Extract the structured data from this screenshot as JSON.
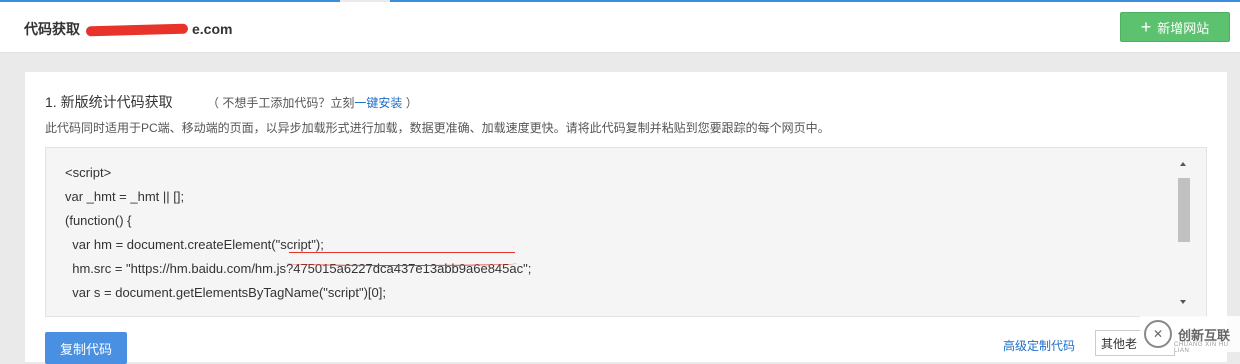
{
  "header": {
    "title": "代码获取",
    "domain_suffix": "e.com",
    "add_site_button": "新增网站",
    "add_site_icon": "plus-icon"
  },
  "section": {
    "title": "1. 新版统计代码获取",
    "hint_prefix": "（ 不想手工添加代码？立刻",
    "hint_link": "一键安装",
    "hint_suffix": " ）",
    "description": "此代码同时适用于PC端、移动端的页面，以异步加载形式进行加载，数据更准确、加载速度更快。请将此代码复制并粘贴到您要跟踪的每个网页中。"
  },
  "code": {
    "lines": [
      "<script>",
      "var _hmt = _hmt || [];",
      "(function() {",
      "  var hm = document.createElement(\"script\");",
      "  hm.src = \"https://hm.baidu.com/hm.js?475015a6227dca437e13abb9a6e845ac\";",
      "  var s = document.getElementsByTagName(\"script\")[0];"
    ]
  },
  "actions": {
    "copy_button": "复制代码",
    "advanced_link": "高级定制代码",
    "select_value": "其他老"
  },
  "watermark": {
    "text": "创新互联",
    "sub": "CHUANG XIN HU LIAN"
  },
  "colors": {
    "accent": "#3c8ddc",
    "primary_button": "#4a90e2",
    "success_button": "#5cc26f",
    "link": "#1c6fc9",
    "redaction": "#e8332a"
  }
}
